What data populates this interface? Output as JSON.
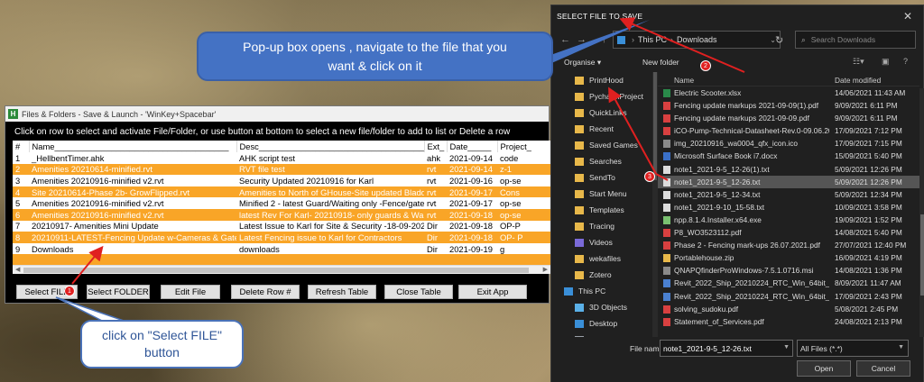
{
  "app": {
    "title": "Files & Folders - Save & Launch - 'WinKey+Spacebar'",
    "instruction": "Click on row to select and activate File/Folder, or use button at bottom to select a new file/folder to add to list or Delete a row",
    "columns": [
      "#",
      "Name_____________________________________",
      "Desc________________________________________",
      "Ext_",
      "Date_____",
      "Project_"
    ],
    "rows": [
      {
        "num": "1",
        "name": "_HellbentTimer.ahk",
        "desc": "AHK script test",
        "ext": "ahk",
        "date": "2021-09-14",
        "project": "code",
        "highlight": false
      },
      {
        "num": "2",
        "name": "Amenities 20210614-minified.rvt",
        "desc": "RVT file test",
        "ext": "rvt",
        "date": "2021-09-14",
        "project": "z-1",
        "highlight": true
      },
      {
        "num": "3",
        "name": "Amenities 20210916-minified v2.rvt",
        "desc": "Security Updated 20210916 for Karl",
        "ext": "rvt",
        "date": "2021-09-16",
        "project": "op-se",
        "highlight": false
      },
      {
        "num": "4",
        "name": "Site 20210614-Phase 2b- GrowFlipped.rvt",
        "desc": "Amenities to North of GHouse-Site updated Bladder/Dry/",
        "ext": "rvt",
        "date": "2021-09-17",
        "project": "Cons",
        "highlight": true
      },
      {
        "num": "5",
        "name": "Amenities 20210916-minified v2.rvt",
        "desc": "Minified 2 - latest Guard/Waiting only -Fence/gate added",
        "ext": "rvt",
        "date": "2021-09-17",
        "project": "op-se",
        "highlight": false
      },
      {
        "num": "6",
        "name": "Amenities 20210916-minified v2.rvt",
        "desc": "latest Rev For Karl- 20210918- only guards & Waiting",
        "ext": "rvt",
        "date": "2021-09-18",
        "project": "op-se",
        "highlight": true
      },
      {
        "num": "7",
        "name": "20210917- Amenities Mini Update",
        "desc": "Latest Issue to Karl for Site & Security -18-09-2021",
        "ext": "Dir",
        "date": "2021-09-18",
        "project": "OP-P",
        "highlight": false
      },
      {
        "num": "8",
        "name": "20210911-LATEST-Fencing Update w-Cameras & Gates",
        "desc": "Latest Fencing issue to Karl for Contractors",
        "ext": "Dir",
        "date": "2021-09-18",
        "project": "OP- P",
        "highlight": true
      },
      {
        "num": "9",
        "name": "Downloads",
        "desc": "downloads",
        "ext": "Dir",
        "date": "2021-09-19",
        "project": "g",
        "highlight": false
      }
    ],
    "buttons": [
      "Select FILE",
      "Select FOLDER",
      "Edit File",
      "Delete Row #",
      "Refresh Table",
      "Close Table",
      "Exit App"
    ]
  },
  "dialog": {
    "title": "SELECT FILE TO SAVE",
    "breadcrumb": [
      "This PC",
      "Downloads"
    ],
    "search_placeholder": "Search Downloads",
    "organise": "Organise",
    "new_folder": "New folder",
    "col_name": "Name",
    "col_date": "Date modified",
    "nav_items": [
      {
        "label": "PrintHood",
        "icon": "folder",
        "color": "#e8b84a"
      },
      {
        "label": "PycharmProject",
        "icon": "folder",
        "color": "#e8b84a"
      },
      {
        "label": "QuickLinks",
        "icon": "folder",
        "color": "#e8b84a"
      },
      {
        "label": "Recent",
        "icon": "folder",
        "color": "#e8b84a"
      },
      {
        "label": "Saved Games",
        "icon": "folder",
        "color": "#e8b84a"
      },
      {
        "label": "Searches",
        "icon": "folder",
        "color": "#e8b84a"
      },
      {
        "label": "SendTo",
        "icon": "folder",
        "color": "#e8b84a"
      },
      {
        "label": "Start Menu",
        "icon": "folder",
        "color": "#e8b84a"
      },
      {
        "label": "Templates",
        "icon": "folder",
        "color": "#e8b84a"
      },
      {
        "label": "Tracing",
        "icon": "folder",
        "color": "#e8b84a"
      },
      {
        "label": "Videos",
        "icon": "folder",
        "color": "#7a6ad8"
      },
      {
        "label": "wekafiles",
        "icon": "folder",
        "color": "#e8b84a"
      },
      {
        "label": "Zotero",
        "icon": "folder",
        "color": "#e8b84a"
      },
      {
        "label": "This PC",
        "icon": "pc",
        "color": "#3a8fd8"
      },
      {
        "label": "3D Objects",
        "icon": "folder",
        "color": "#5ab0e8"
      },
      {
        "label": "Desktop",
        "icon": "folder",
        "color": "#3a8fd8"
      },
      {
        "label": "Documents",
        "icon": "folder",
        "color": "#9aa0a8"
      },
      {
        "label": "Downloads",
        "icon": "download",
        "color": "#3a8fd8",
        "selected": true
      }
    ],
    "files": [
      {
        "name": "Electric Scooter.xlsx",
        "date": "14/06/2021 11:43 AM",
        "color": "#2a8a4a"
      },
      {
        "name": "Fencing update markups 2021-09-09(1).pdf",
        "date": "9/09/2021 6:11 PM",
        "color": "#d84040"
      },
      {
        "name": "Fencing update markups 2021-09-09.pdf",
        "date": "9/09/2021 6:11 PM",
        "color": "#d84040"
      },
      {
        "name": "iCO-Pump-Technical-Datasheet-Rev.0-09.06.20",
        "date": "17/09/2021 7:12 PM",
        "color": "#d84040"
      },
      {
        "name": "img_20210916_wa0004_qfx_icon.ico",
        "date": "17/09/2021 7:15 PM",
        "color": "#8a8a8a"
      },
      {
        "name": "Microsoft Surface Book i7.docx",
        "date": "15/09/2021 5:40 PM",
        "color": "#3a70c8"
      },
      {
        "name": "note1_2021-9-5_12-26(1).txt",
        "date": "5/09/2021 12:26 PM",
        "color": "#dddddd"
      },
      {
        "name": "note1_2021-9-5_12-26.txt",
        "date": "5/09/2021 12:26 PM",
        "color": "#dddddd",
        "selected": true
      },
      {
        "name": "note1_2021-9-5_12-34.txt",
        "date": "5/09/2021 12:34 PM",
        "color": "#dddddd"
      },
      {
        "name": "note1_2021-9-10_15-58.txt",
        "date": "10/09/2021 3:58 PM",
        "color": "#dddddd"
      },
      {
        "name": "npp.8.1.4.Installer.x64.exe",
        "date": "19/09/2021 1:52 PM",
        "color": "#7ac070"
      },
      {
        "name": "P8_WO3523112.pdf",
        "date": "14/08/2021 5:40 PM",
        "color": "#d84040"
      },
      {
        "name": "Phase 2 - Fencing mark-ups 26.07.2021.pdf",
        "date": "27/07/2021 12:40 PM",
        "color": "#d84040"
      },
      {
        "name": "Portablehouse.zip",
        "date": "16/09/2021 4:19 PM",
        "color": "#e8b84a"
      },
      {
        "name": "QNAPQfinderProWindows-7.5.1.0716.msi",
        "date": "14/08/2021 1:36 PM",
        "color": "#8a8a8a"
      },
      {
        "name": "Revit_2022_Ship_20210224_RTC_Win_64bit_di_",
        "date": "8/09/2021 11:47 AM",
        "color": "#4a80d0"
      },
      {
        "name": "Revit_2022_Ship_20210224_RTC_Win_64bit_di_",
        "date": "17/09/2021 2:43 PM",
        "color": "#4a80d0"
      },
      {
        "name": "solving_sudoku.pdf",
        "date": "5/08/2021 2:45 PM",
        "color": "#d84040"
      },
      {
        "name": "Statement_of_Services.pdf",
        "date": "24/08/2021 2:13 PM",
        "color": "#d84040"
      }
    ],
    "file_name_label": "File name:",
    "file_name_value": "note1_2021-9-5_12-26.txt",
    "file_type": "All Files (*.*)",
    "open_label": "Open",
    "cancel_label": "Cancel"
  },
  "callouts": {
    "top_line1": "Pop-up box opens , navigate to the file that you",
    "top_line2": "want & click on it",
    "bottom_line1": "click on \"Select FILE\"",
    "bottom_line2": "button",
    "badges": [
      "1",
      "2",
      "3"
    ]
  },
  "colors": {
    "orange_row": "#f9a527",
    "callout_blue": "#4472c4",
    "arrow_red": "#e02020",
    "dialog_bg": "#202020"
  }
}
